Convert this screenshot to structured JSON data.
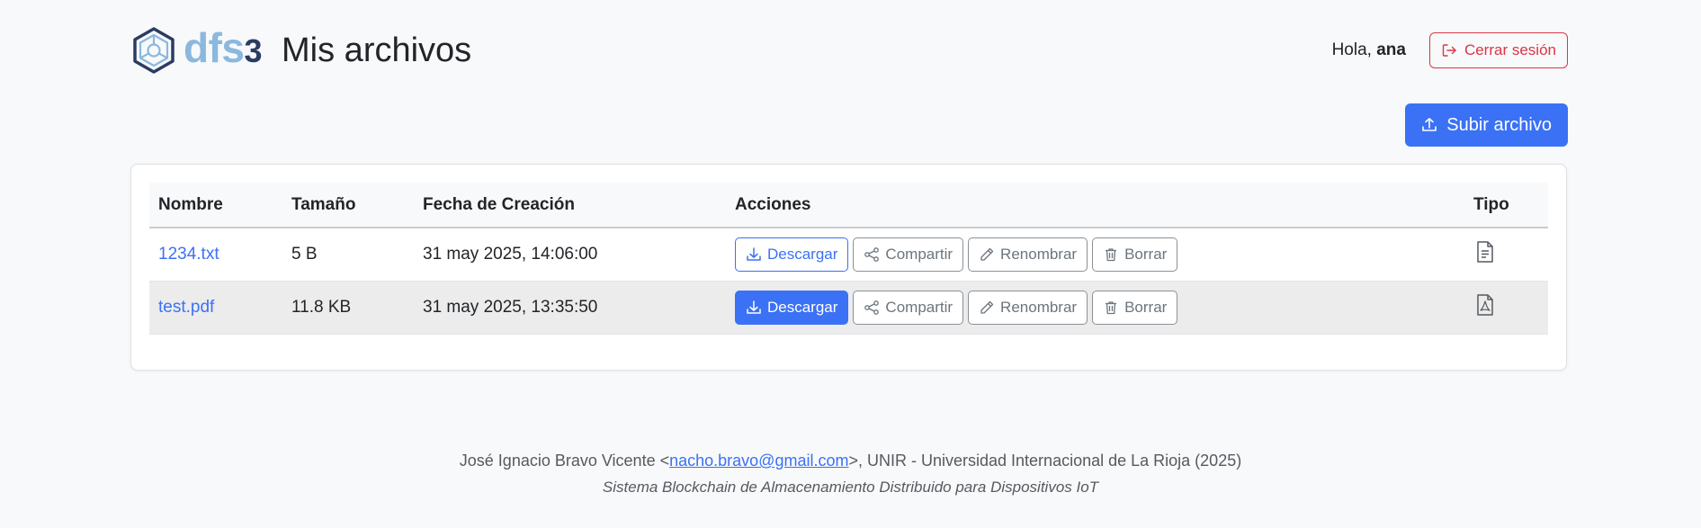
{
  "header": {
    "logo_text_main": "dfs",
    "logo_text_suffix": "3",
    "page_title": "Mis archivos",
    "greeting_prefix": "Hola, ",
    "username": "ana",
    "logout_label": "Cerrar sesión"
  },
  "toolbar": {
    "upload_label": "Subir archivo"
  },
  "table": {
    "columns": {
      "name": "Nombre",
      "size": "Tamaño",
      "created": "Fecha de Creación",
      "actions": "Acciones",
      "type": "Tipo"
    },
    "action_labels": {
      "download": "Descargar",
      "share": "Compartir",
      "rename": "Renombrar",
      "delete": "Borrar"
    },
    "rows": [
      {
        "name": "1234.txt",
        "size": "5 B",
        "created": "31 may 2025, 14:06:00",
        "type_icon": "file-text-icon"
      },
      {
        "name": "test.pdf",
        "size": "11.8 KB",
        "created": "31 may 2025, 13:35:50",
        "type_icon": "file-pdf-icon"
      }
    ]
  },
  "footer": {
    "author_prefix": "José Ignacio Bravo Vicente <",
    "email": "nacho.bravo@gmail.com",
    "author_suffix": ">, UNIR - Universidad Internacional de La Rioja (2025)",
    "subtitle": "Sistema Blockchain de Almacenamiento Distribuido para Dispositivos IoT"
  },
  "colors": {
    "primary": "#3b71f5",
    "danger": "#dc3545",
    "logo_light": "#8bb8de",
    "logo_dark": "#2b3c63"
  }
}
